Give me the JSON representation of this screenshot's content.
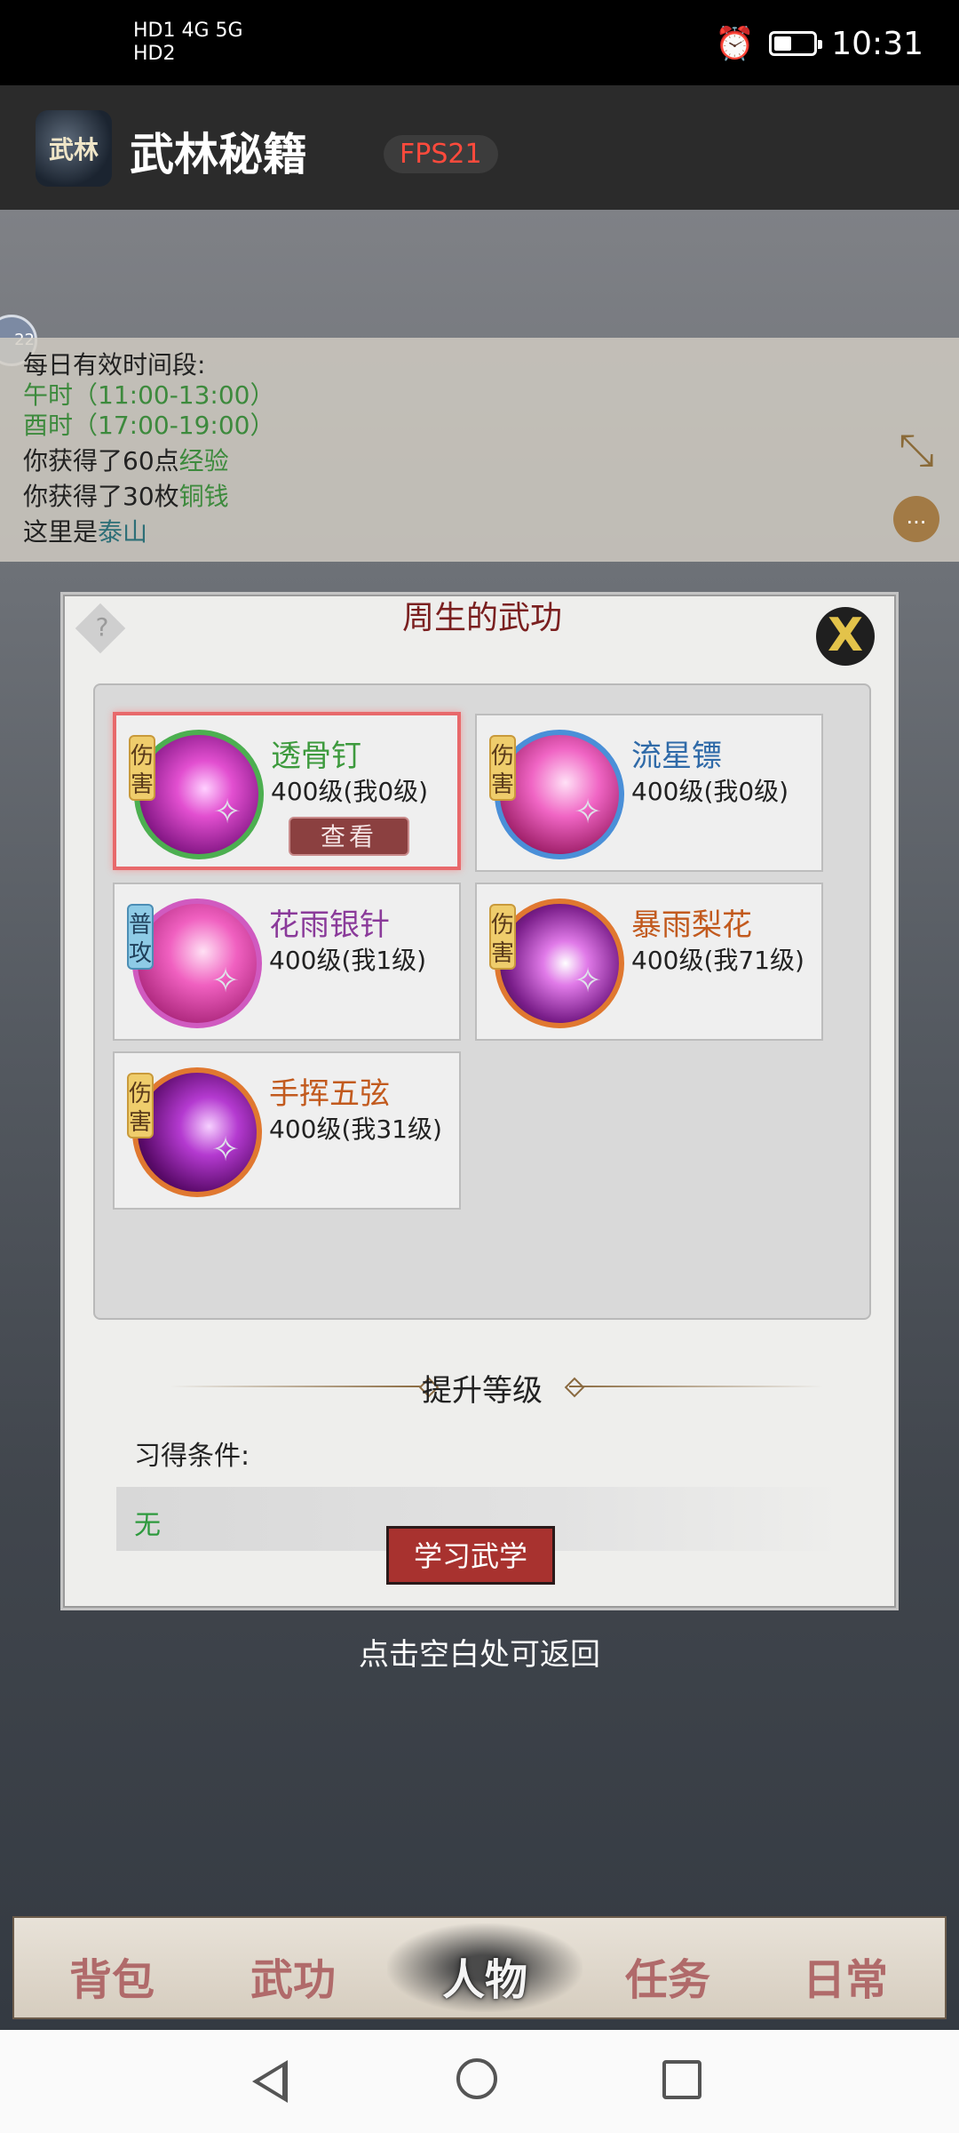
{
  "status_bar": {
    "network_text": "HD1 4G  5G",
    "network_text2": "HD2",
    "time": "10:31",
    "battery_level": 0.45
  },
  "app": {
    "title": "武林秘籍",
    "icon_text": "武林",
    "fps": "FPS21"
  },
  "chat": {
    "avatar_badge": "22",
    "lines": [
      {
        "plain": "每日有效时间段:"
      },
      {
        "highlight": "午时（11:00-13:00）"
      },
      {
        "highlight": "酉时（17:00-19:00）"
      },
      {
        "plain": "你获得了60点",
        "highlight": "经验"
      },
      {
        "plain": "你获得了30枚",
        "highlight": "铜钱"
      },
      {
        "plain": "这里是",
        "highlight": "泰山"
      }
    ],
    "chat_icon": "..."
  },
  "dialog": {
    "title": "周生的武功",
    "help_icon": "?",
    "close_icon": "X",
    "skills": [
      {
        "tag": "伤害",
        "name": "透骨钉",
        "level": "400级(我0级)",
        "view_label": "查看",
        "name_color": "#3d9a3d"
      },
      {
        "tag": "伤害",
        "name": "流星镖",
        "level": "400级(我0级)",
        "name_color": "#2f6aa8"
      },
      {
        "tag": "普攻",
        "name": "花雨银针",
        "level": "400级(我1级)",
        "name_color": "#8a3a9a"
      },
      {
        "tag": "伤害",
        "name": "暴雨梨花",
        "level": "400级(我71级)",
        "name_color": "#c25a1e"
      },
      {
        "tag": "伤害",
        "name": "手挥五弦",
        "level": "400级(我31级)",
        "name_color": "#c25a1e"
      }
    ],
    "section_title": "提升等级",
    "condition_label": "习得条件:",
    "condition_value": "无",
    "learn_button": "学习武学"
  },
  "back_hint": "点击空白处可返回",
  "tabs": [
    {
      "label": "背包",
      "active": false
    },
    {
      "label": "武功",
      "active": false
    },
    {
      "label": "人物",
      "active": true
    },
    {
      "label": "任务",
      "active": false
    },
    {
      "label": "日常",
      "active": false
    }
  ]
}
